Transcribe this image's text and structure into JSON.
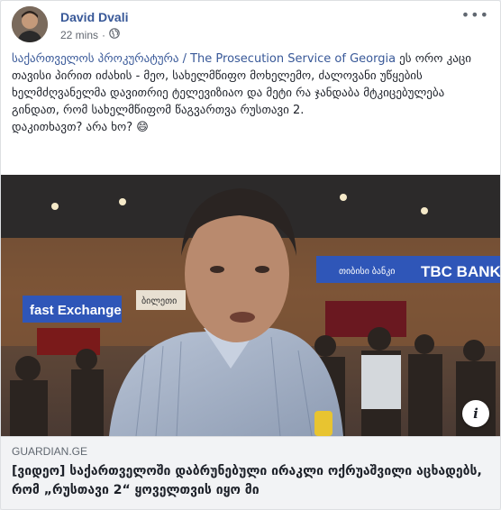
{
  "post": {
    "author": "David Dvali",
    "time": "22 mins",
    "privacy_icon": "globe-icon",
    "menu_icon": "more-dots-icon",
    "link_text": "საქართველოს პროკურატურა / The Prosecution Service of Georgia",
    "text_after_link": " ეს ორო კაცი თავისი პირით იძახის - მეო, სახელმწიფო მოხელემო, ძალოვანი უწყების ხელმძღვანელმა დავითრიე ტელევიზიაო და მეტი რა ჯანდაბა მტკიცებულება გინდათ, რომ სახელმწიფომ წაგვართვა რუსთავი 2.",
    "line2": "დაკითხავთ? არა ხო? ",
    "emoji": "😄"
  },
  "media": {
    "signs": {
      "fast_exchange": "fast Exchange",
      "bank_geo": "თიბისი ბანკი",
      "tbc_bank": "TBC BANK",
      "small_sign": "ბილეთი"
    },
    "info_icon": "info-icon"
  },
  "link": {
    "domain": "GUARDIAN.GE",
    "title": "[ვიდეო] საქართველოში დაბრუნებული ირაკლი ოქრუაშვილი აცხადებს, რომ „რუსთავი 2“ ყოველთვის იყო მი"
  },
  "colors": {
    "author_link": "#385898",
    "link_box_bg": "#f2f3f5",
    "sign_blue": "#2f56b8"
  }
}
